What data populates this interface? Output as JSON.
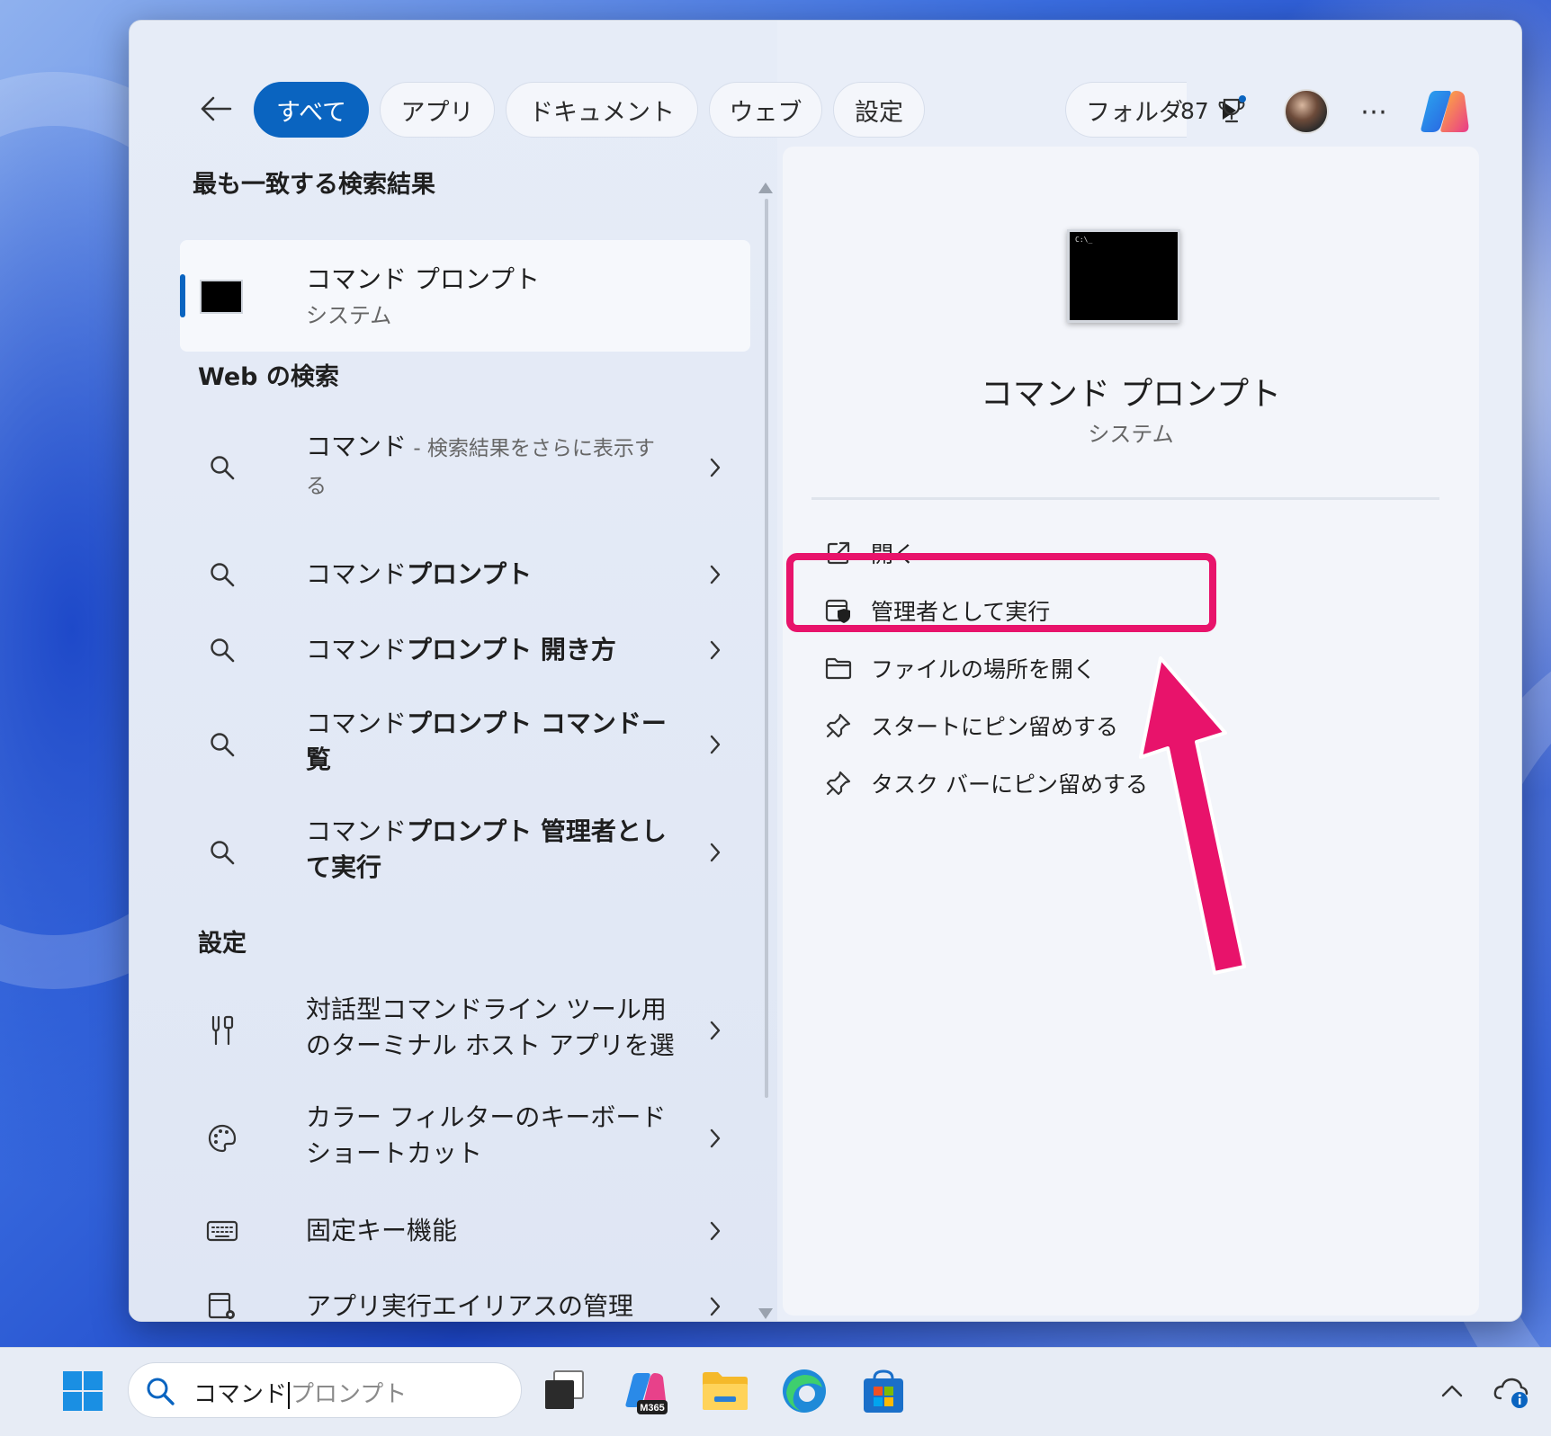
{
  "filters": {
    "back": "back",
    "chips": [
      "すべて",
      "アプリ",
      "ドキュメント",
      "ウェブ",
      "設定"
    ],
    "cut_chip": "フォルダ",
    "points": "87"
  },
  "best_match": {
    "section": "最も一致する検索結果",
    "name": "コマンド プロンプト",
    "sub": "システム"
  },
  "web": {
    "section": "Web の検索",
    "items": [
      {
        "pre": "コマンド",
        "hint": " - 検索結果をさらに表示す",
        "hint2": "る"
      },
      {
        "pre": "コマンド",
        "bold": "プロンプト"
      },
      {
        "pre": "コマンド",
        "bold": "プロンプト 開き方"
      },
      {
        "pre": "コマンド",
        "bold": "プロンプト コマンドー",
        "bold2": "覧"
      },
      {
        "pre": "コマンド",
        "bold": "プロンプト 管理者とし",
        "bold2": "て実行"
      }
    ]
  },
  "settings": {
    "section": "設定",
    "items": [
      {
        "line1": "対話型コマンドライン ツール用",
        "line2": "のターミナル ホスト アプリを選"
      },
      {
        "line1": "カラー フィルターのキーボード",
        "line2": "ショートカット"
      },
      {
        "line1": "固定キー機能"
      },
      {
        "line1": "アプリ実行エイリアスの管理"
      }
    ]
  },
  "detail": {
    "icon_text": "C:\\_",
    "title": "コマンド プロンプト",
    "sub": "システム",
    "actions": [
      "開く",
      "管理者として実行",
      "ファイルの場所を開く",
      "スタートにピン留めする",
      "タスク バーにピン留めする"
    ]
  },
  "taskbar": {
    "typed": "コマンド",
    "ghost": "プロンプト",
    "m365_badge": "M365"
  },
  "colors": {
    "accent": "#0a64c0",
    "highlight": "#e8136b"
  }
}
